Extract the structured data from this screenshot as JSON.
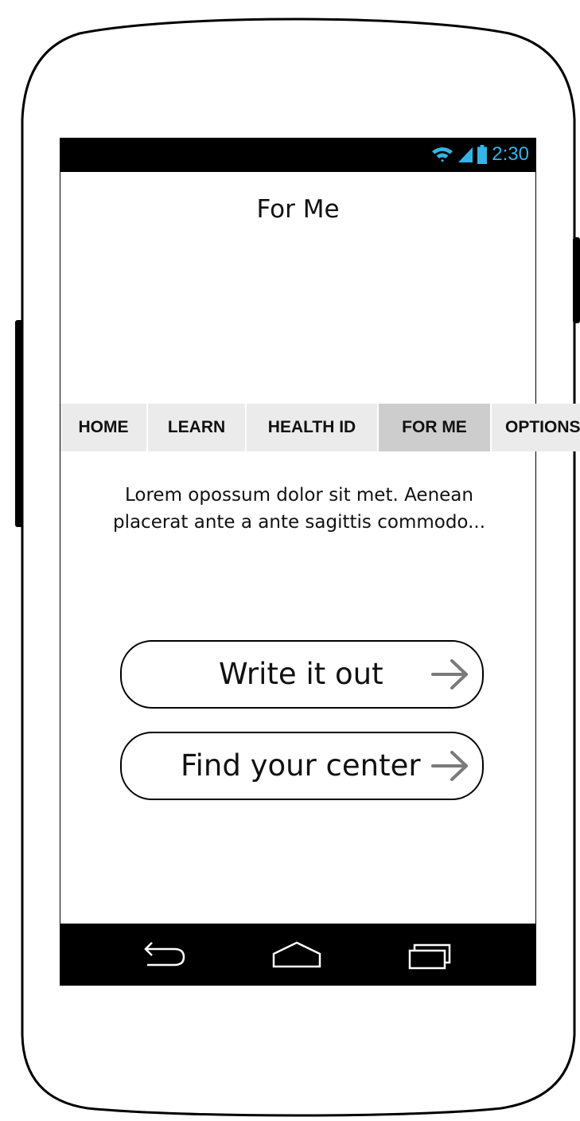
{
  "status_bar": {
    "time": "2:30",
    "icons": [
      "wifi-icon",
      "signal-icon",
      "battery-icon"
    ],
    "accent_color": "#33b5e5"
  },
  "header": {
    "title": "For Me"
  },
  "tabs": [
    {
      "label": "HOME",
      "active": false
    },
    {
      "label": "LEARN",
      "active": false
    },
    {
      "label": "HEALTH ID",
      "active": false
    },
    {
      "label": "FOR ME",
      "active": true
    },
    {
      "label": "OPTIONS",
      "active": false
    }
  ],
  "main": {
    "intro": "Lorem opossum dolor sit met. Aenean placerat ante a ante sagittis commodo...",
    "buttons": [
      {
        "label": "Write it out",
        "icon": "arrow-right-icon"
      },
      {
        "label": "Find your center",
        "icon": "arrow-right-icon"
      }
    ]
  },
  "nav_bar": {
    "icons": [
      "back-icon",
      "home-icon",
      "recents-icon"
    ]
  }
}
